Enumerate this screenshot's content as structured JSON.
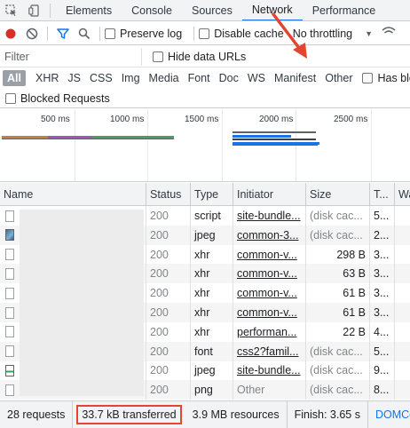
{
  "tabs": {
    "items": [
      "Elements",
      "Console",
      "Sources",
      "Network",
      "Performance"
    ],
    "active_index": 3
  },
  "toolbar": {
    "preserve_log": "Preserve log",
    "disable_cache": "Disable cache",
    "throttling": "No throttling"
  },
  "filter": {
    "placeholder": "Filter",
    "hide_data_urls": "Hide data URLs"
  },
  "types": {
    "items": [
      "All",
      "XHR",
      "JS",
      "CSS",
      "Img",
      "Media",
      "Font",
      "Doc",
      "WS",
      "Manifest",
      "Other"
    ],
    "has_blocked": "Has block"
  },
  "blocked_requests": "Blocked Requests",
  "overview": {
    "ticks": [
      "500 ms",
      "1000 ms",
      "1500 ms",
      "2000 ms",
      "2500 ms"
    ]
  },
  "table": {
    "headers": [
      "Name",
      "Status",
      "Type",
      "Initiator",
      "Size",
      "T...",
      "Wa"
    ],
    "rows": [
      {
        "status": "200",
        "type": "script",
        "initiator": "site-bundle...",
        "size": "(disk cac...",
        "time": "5...",
        "icon": "file"
      },
      {
        "status": "200",
        "type": "jpeg",
        "initiator": "common-3...",
        "size": "(disk cac...",
        "time": "2...",
        "icon": "image"
      },
      {
        "status": "200",
        "type": "xhr",
        "initiator": "common-v...",
        "size": "298 B",
        "time": "3...",
        "icon": "file"
      },
      {
        "status": "200",
        "type": "xhr",
        "initiator": "common-v...",
        "size": "63 B",
        "time": "3...",
        "icon": "file"
      },
      {
        "status": "200",
        "type": "xhr",
        "initiator": "common-v...",
        "size": "61 B",
        "time": "3...",
        "icon": "file"
      },
      {
        "status": "200",
        "type": "xhr",
        "initiator": "common-v...",
        "size": "61 B",
        "time": "3...",
        "icon": "file"
      },
      {
        "status": "200",
        "type": "xhr",
        "initiator": "performan...",
        "size": "22 B",
        "time": "4...",
        "icon": "file"
      },
      {
        "status": "200",
        "type": "font",
        "initiator": "css2?famil...",
        "size": "(disk cac...",
        "time": "5...",
        "icon": "file"
      },
      {
        "status": "200",
        "type": "jpeg",
        "initiator": "site-bundle...",
        "size": "(disk cac...",
        "time": "9...",
        "icon": "image2"
      },
      {
        "status": "200",
        "type": "png",
        "initiator": "Other",
        "size": "(disk cac...",
        "time": "8...",
        "icon": "file"
      }
    ]
  },
  "status": {
    "requests": "28 requests",
    "transferred": "33.7 kB transferred",
    "resources": "3.9 MB resources",
    "finish": "Finish: 3.65 s",
    "domcontent": "DOMCon"
  },
  "colors": {
    "accent": "#1a73e8",
    "highlight": "#e3452f",
    "record": "#d93025"
  }
}
